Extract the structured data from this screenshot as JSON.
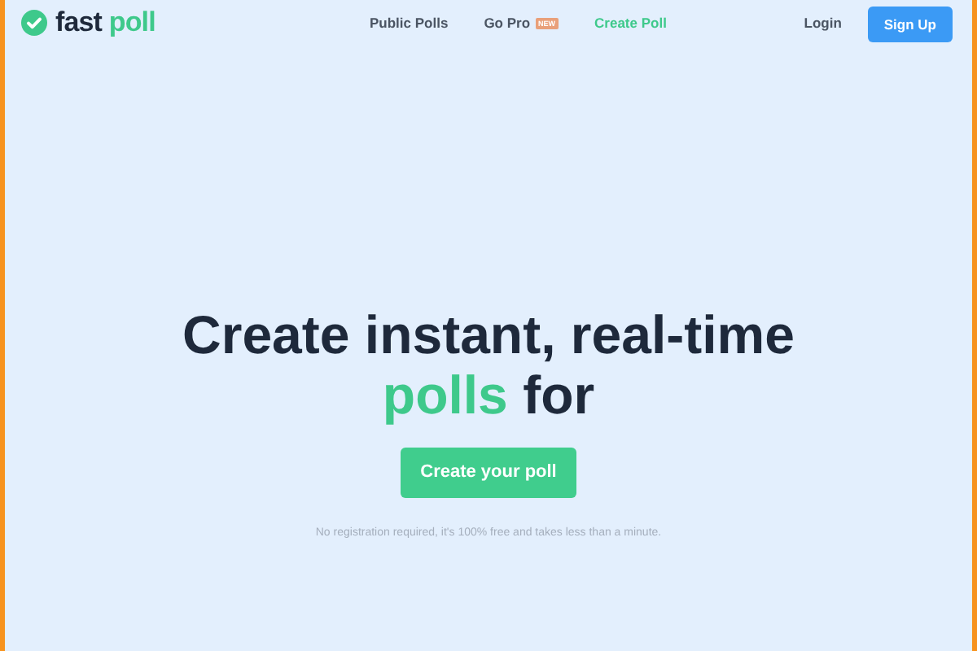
{
  "logo": {
    "word_1": "fast",
    "word_2": "poll"
  },
  "nav": [
    {
      "label": "Public Polls",
      "selected": false
    },
    {
      "label": "Go Pro",
      "selected": false,
      "badge": "NEW"
    },
    {
      "label": "Create Poll",
      "selected": true
    }
  ],
  "login": "Login",
  "signup": "Sign Up",
  "hero": {
    "title_line_1": "Create instant, real-time",
    "title_highlight": "polls",
    "title_rest": " for",
    "button": "Create your poll",
    "note": "No registration required, it's 100% free and takes less than a minute."
  }
}
